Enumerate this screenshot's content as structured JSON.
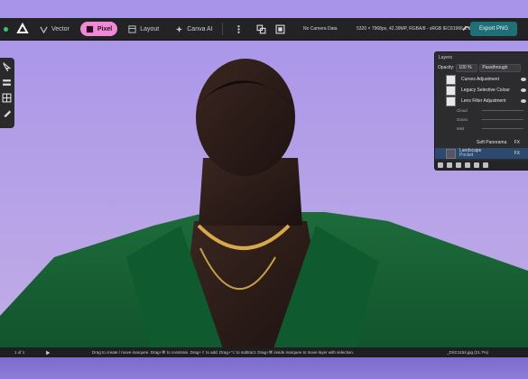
{
  "toolbar": {
    "personas": [
      "Vector",
      "Pixel",
      "Layout",
      "Canva AI"
    ],
    "active_persona": "Pixel",
    "camera": "No Camera Data",
    "doc_info": "5320 × 7968px, 42.39MP, RGBA/8 - sRGB IEC61966-2.1",
    "export_label": "Export PNG"
  },
  "layers": {
    "title": "Layers",
    "opacity_label": "Opacity:",
    "opacity_value": "100 %",
    "blend_mode": "Passthrough",
    "items": [
      {
        "name": "Curves Adjustment"
      },
      {
        "name": "Legacy Selective Colour"
      },
      {
        "name": "Lens Filter Adjustment"
      }
    ],
    "sliders": [
      "Cloud",
      "Grass",
      "Mist"
    ],
    "filter_row_label": "Soft Panorama",
    "selected_layer": {
      "name": "Landscape",
      "sub": "Pocket"
    },
    "fx_label": "FX"
  },
  "status": {
    "page": "1 of 1",
    "hint": "Drag to create / move marquee. Drag+⌘ to constrain. Drag+⇧ to add. Drag+⌥ to subtract. Drag+⌘ inside marquee to move layer with selection.",
    "file": "_DSC1154.jpg (21.7%)"
  }
}
